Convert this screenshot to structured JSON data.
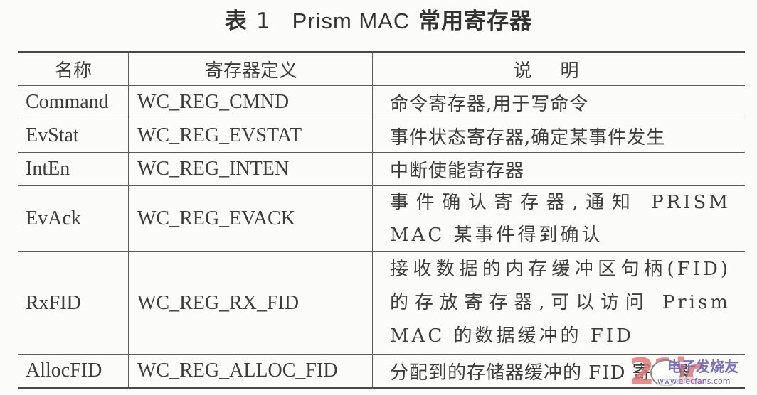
{
  "title": {
    "prefix": "表",
    "number": "1",
    "latin": "Prism MAC",
    "suffix": "常用寄存器"
  },
  "table": {
    "headers": [
      "名称",
      "寄存器定义",
      "说明"
    ],
    "rows": [
      {
        "name": "Command",
        "definition": "WC_REG_CMND",
        "description": "命令寄存器,用于写命令"
      },
      {
        "name": "EvStat",
        "definition": "WC_REG_EVSTAT",
        "description": "事件状态寄存器,确定某事件发生"
      },
      {
        "name": "IntEn",
        "definition": "WC_REG_INTEN",
        "description": "中断使能寄存器"
      },
      {
        "name": "EvAck",
        "definition": "WC_REG_EVACK",
        "description": "事件确认寄存器,通知 PRISM MAC 某事件得到确认"
      },
      {
        "name": "RxFID",
        "definition": "WC_REG_RX_FID",
        "description": "接收数据的内存缓冲区句柄(FID)的存放寄存器,可以访问 Prism MAC 的数据缓冲的 FID"
      },
      {
        "name": "AllocFID",
        "definition": "WC_REG_ALLOC_FID",
        "description": "分配到的存储器缓冲的 FID 寄存器"
      }
    ]
  },
  "watermark": {
    "number": "21ic",
    "cn": "电子发烧友",
    "url": "www.elecfans.com"
  }
}
